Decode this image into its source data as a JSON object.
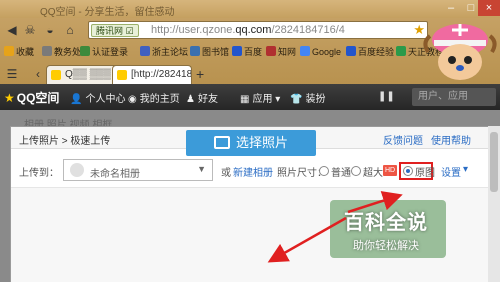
{
  "window": {
    "title": "QQ空间 - 分享生活，留住感动",
    "min": "–",
    "max": "□",
    "close": "×"
  },
  "address_bar": {
    "site_badge": "腾讯网 ☑",
    "url_prefix": "http://user.qzone.",
    "url_domain": "qq.com",
    "url_suffix": "/2824184716/4",
    "star": "★"
  },
  "bookmarks": [
    {
      "label": "收藏",
      "color": "#e6a31a"
    },
    {
      "label": "教务处",
      "color": "#7a7a7a"
    },
    {
      "label": "认证登录",
      "color": "#3c8a3c"
    },
    {
      "label": "浙主论坛",
      "color": "#4060c0"
    },
    {
      "label": "图书馆",
      "color": "#3a70b0"
    },
    {
      "label": "百度",
      "color": "#2255cc"
    },
    {
      "label": "知网",
      "color": "#b03030"
    },
    {
      "label": "Google",
      "color": "#4285f4"
    },
    {
      "label": "百度经验",
      "color": "#2255cc"
    },
    {
      "label": "天正教程",
      "color": "#2a9a4a"
    }
  ],
  "tabs": [
    {
      "label": "Q▒▒ ▒▒▒"
    },
    {
      "label": "[http://282418"
    }
  ],
  "new_tab": "+",
  "qq_nav": {
    "logo": "QQ空间",
    "items": [
      {
        "icon": "👤",
        "label": "个人中心"
      },
      {
        "icon": "◉",
        "label": "我的主页"
      },
      {
        "icon": "♟",
        "label": "好友"
      },
      {
        "icon": "▦",
        "label": "应用"
      },
      {
        "icon": "👕",
        "label": "装扮"
      }
    ],
    "pause": "❚❚",
    "search_placeholder": "用户、应用"
  },
  "background_tabs": "相册    照片    视频    相框",
  "dialog": {
    "breadcrumb": "上传照片 > 极速上传",
    "feedback": "反馈问题",
    "help": "使用帮助",
    "upload_to_label": "上传到：",
    "album_name": "未命名相册",
    "or": "或",
    "new_album": "新建相册",
    "size_label": "照片尺寸：",
    "option_normal": "普通",
    "option_large": "超大",
    "hd": "HD",
    "option_original": "原图",
    "settings": "设置",
    "upload_button": "选择照片"
  },
  "watermark": {
    "title": "百科全说",
    "subtitle": "助你轻松解决"
  }
}
